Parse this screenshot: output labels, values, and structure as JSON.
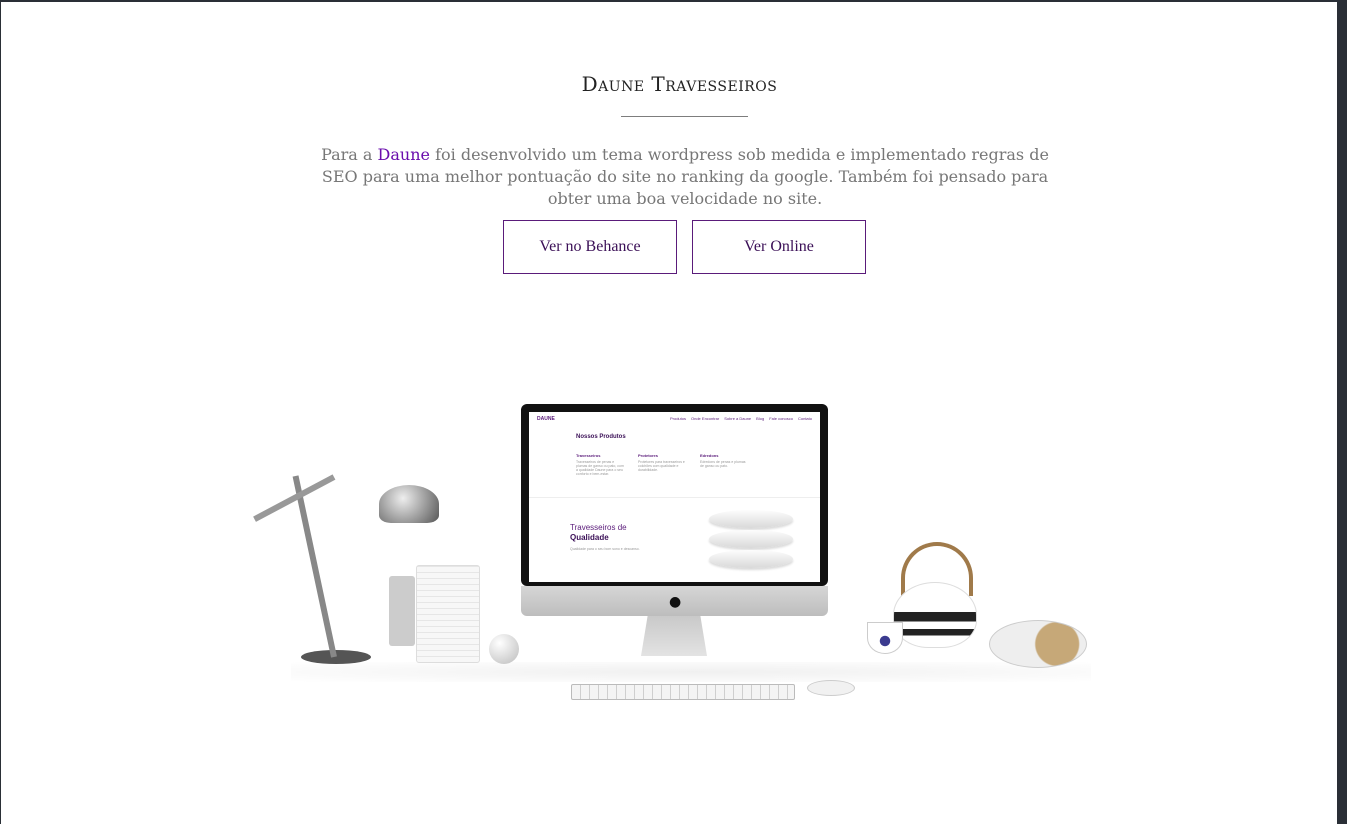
{
  "section": {
    "title": "Daune Travesseiros",
    "description_prefix": "Para a ",
    "brand_link": "Daune",
    "description_suffix": " foi desenvolvido um tema wordpress sob medida e implementado regras de SEO para uma melhor pontuação do site no ranking da google. Também foi pensado para obter uma boa velocidade no site."
  },
  "buttons": {
    "behance": "Ver no Behance",
    "online": "Ver Online"
  },
  "mockup_screen": {
    "logo": "DAUNE",
    "nav": [
      "Produtos",
      "Onde Encontrar",
      "Sobre a Daune",
      "Blog",
      "Fale conosco",
      "Contato"
    ],
    "products_title": "Nossos Produtos",
    "columns": [
      {
        "title": "Travesseiros",
        "text": "Travesseiros de penas e plumas de ganso ou pato, com a qualidade Daune para o seu conforto e bem-estar."
      },
      {
        "title": "Protetores",
        "text": "Protetores para travesseiros e colchões com qualidade e durabilidade."
      },
      {
        "title": "Edredons",
        "text": "Edredons de penas e plumas de ganso ou pato."
      }
    ],
    "hero_line1": "Travesseiros de",
    "hero_line2": "Qualidade",
    "hero_text": "Qualidade para o seu bom sono e descanso."
  },
  "colors": {
    "accent": "#6a0dad",
    "button_border": "#5a1b7a",
    "text_gray": "#777777"
  }
}
